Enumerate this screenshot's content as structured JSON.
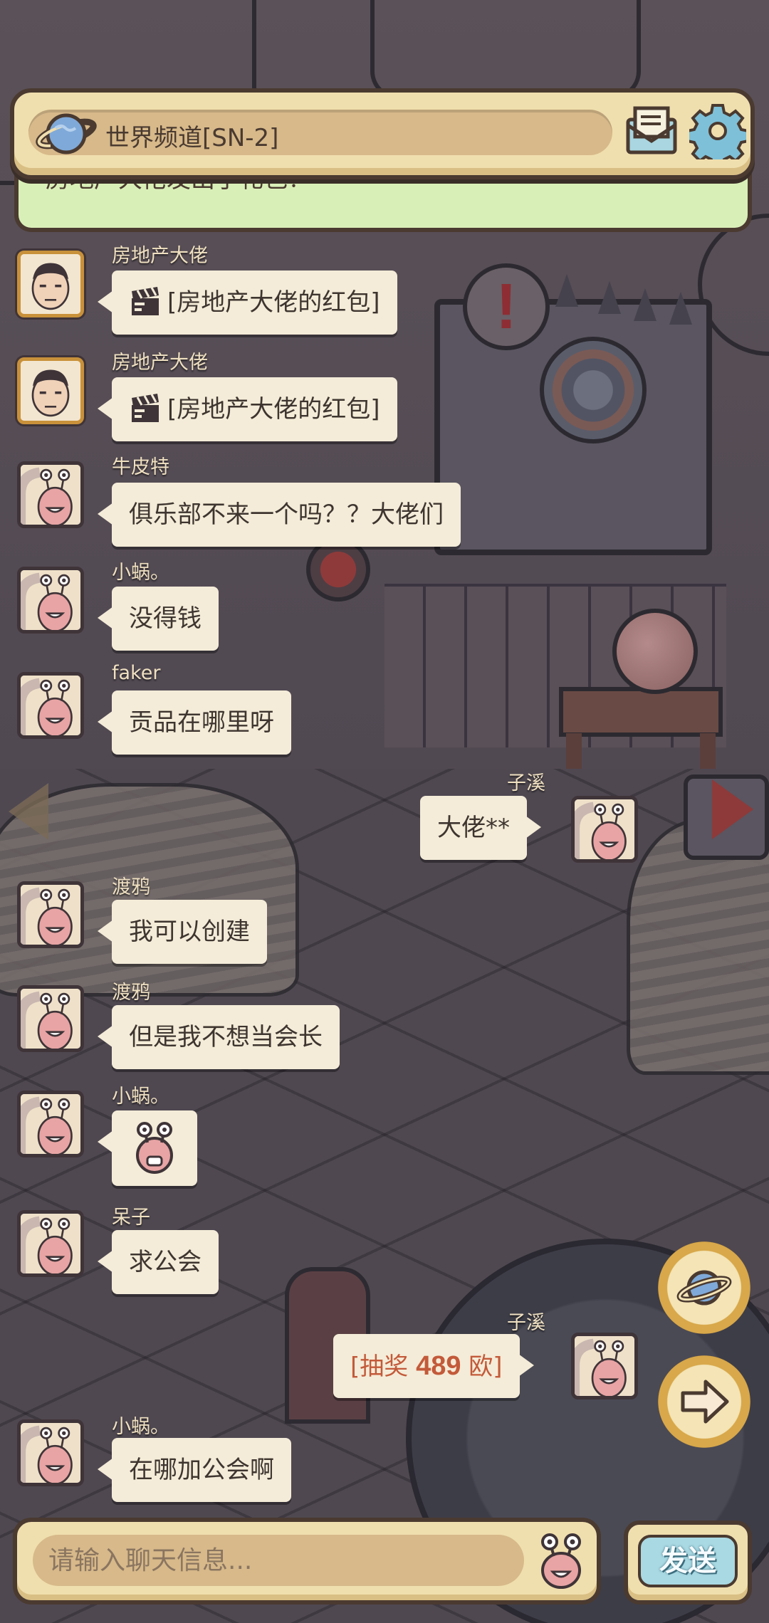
{
  "header": {
    "channel_title": "世界频道[SN-2]",
    "planet_icon": "planet-icon",
    "mail_icon": "mail-icon",
    "settings_icon": "gear-icon"
  },
  "notice": {
    "text": "房地产大佬发出了礼包！"
  },
  "messages": [
    {
      "name": "房地产大佬",
      "text": "[房地产大佬的红包]",
      "side": "left",
      "avatar": "man-portrait",
      "icon": "clapperboard-icon"
    },
    {
      "name": "房地产大佬",
      "text": "[房地产大佬的红包]",
      "side": "left",
      "avatar": "man-portrait",
      "icon": "clapperboard-icon"
    },
    {
      "name": "牛皮特",
      "text": "俱乐部不来一个吗？？大佬们",
      "side": "left",
      "avatar": "snail"
    },
    {
      "name": "小蜗。",
      "text": "没得钱",
      "side": "left",
      "avatar": "snail"
    },
    {
      "name": "faker",
      "text": "贡品在哪里呀",
      "side": "left",
      "avatar": "snail"
    },
    {
      "name": "子溪",
      "text": "大佬**",
      "side": "right",
      "avatar": "snail"
    },
    {
      "name": "渡鸦",
      "text": "我可以创建",
      "side": "left",
      "avatar": "snail"
    },
    {
      "name": "渡鸦",
      "text": "但是我不想当会长",
      "side": "left",
      "avatar": "snail"
    },
    {
      "name": "小蜗。",
      "text": "",
      "side": "left",
      "avatar": "snail",
      "sticker": "snail-face-sticker"
    },
    {
      "name": "呆子",
      "text": "求公会",
      "side": "left",
      "avatar": "snail"
    },
    {
      "name": "子溪",
      "text": "",
      "side": "right",
      "avatar": "snail",
      "lottery": {
        "prefix": "[抽奖 ",
        "amount": "489",
        "suffix": " 欧]"
      }
    },
    {
      "name": "小蜗。",
      "text": "在哪加公会啊",
      "side": "left",
      "avatar": "snail"
    }
  ],
  "side_buttons": {
    "world": "planet-icon",
    "next": "arrow-right-icon"
  },
  "input": {
    "placeholder": "请输入聊天信息...",
    "value": "",
    "emoji_icon": "snail-emoji-icon"
  },
  "send": {
    "label": "发送"
  },
  "colors": {
    "panel": "#f0dfae",
    "panel_border": "#4a3a30",
    "bubble": "#f4ecd8",
    "notice": "#d9efb8",
    "lottery": "#c35a3a"
  }
}
